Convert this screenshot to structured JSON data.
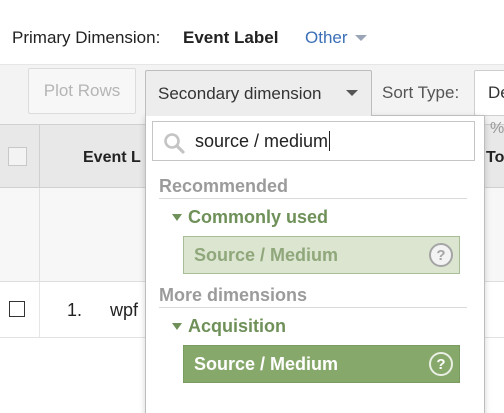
{
  "primary": {
    "label": "Primary Dimension:",
    "value": "Event Label",
    "other": "Other"
  },
  "toolbar": {
    "plot_rows": "Plot Rows",
    "secondary_dimension": "Secondary dimension",
    "sort_type_label": "Sort Type:",
    "sort_type_value": "De"
  },
  "table": {
    "header_label": "Event L",
    "header_right": "To",
    "total_suffix": "%",
    "rows": [
      {
        "index": "1.",
        "label": "wpf"
      }
    ]
  },
  "dropdown": {
    "search_value": "source / medium",
    "recommended": {
      "title": "Recommended",
      "subgroup": "Commonly used",
      "option": "Source / Medium"
    },
    "more": {
      "title": "More dimensions",
      "subgroup": "Acquisition",
      "option": "Source / Medium"
    },
    "help_glyph": "?"
  },
  "colors": {
    "link": "#3b6fb6",
    "green_text": "#6f9159",
    "option_light_bg": "#dbe5d0",
    "option_dark_bg": "#87a86b"
  }
}
